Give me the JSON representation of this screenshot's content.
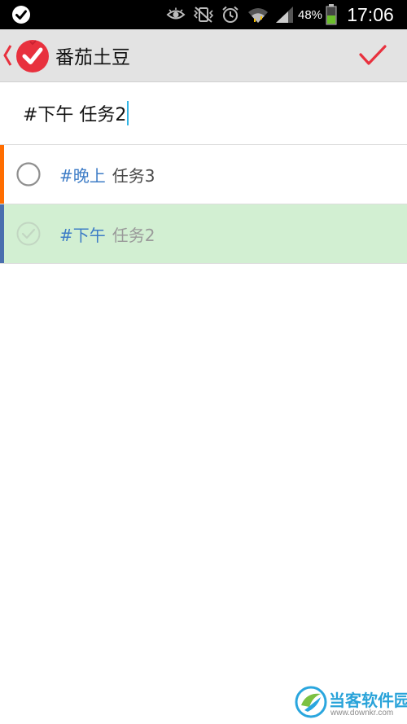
{
  "status_bar": {
    "battery_pct": "48%",
    "battery_level": 0.48,
    "time": "17:06",
    "icons": [
      "check-circle-icon",
      "eye-icon",
      "vibrate-mute-icon",
      "alarm-clock-icon",
      "wifi-icon",
      "cell-signal-icon",
      "battery-icon"
    ]
  },
  "action_bar": {
    "title": "番茄土豆",
    "icons": [
      "back-chevron-icon",
      "tomato-check-logo-icon",
      "confirm-check-icon"
    ]
  },
  "edit_field": {
    "value": "#下午 任务2"
  },
  "tasks": [
    {
      "tag": "#晚上",
      "title": "任务3",
      "completed": false,
      "priority_color": "#ff6d00",
      "background": "#ffffff"
    },
    {
      "tag": "#下午",
      "title": "任务2",
      "completed": true,
      "priority_color": "#4a6fae",
      "background": "#d2efd2"
    }
  ],
  "watermark": {
    "name": "当客软件园",
    "url": "www.downkr.com"
  },
  "colors": {
    "accent_red": "#e8313e",
    "tag_blue": "#3d7cc6",
    "cursor_blue": "#33b5e5",
    "selected_row": "#d2efd2",
    "action_bar_bg": "#e3e3e3"
  }
}
